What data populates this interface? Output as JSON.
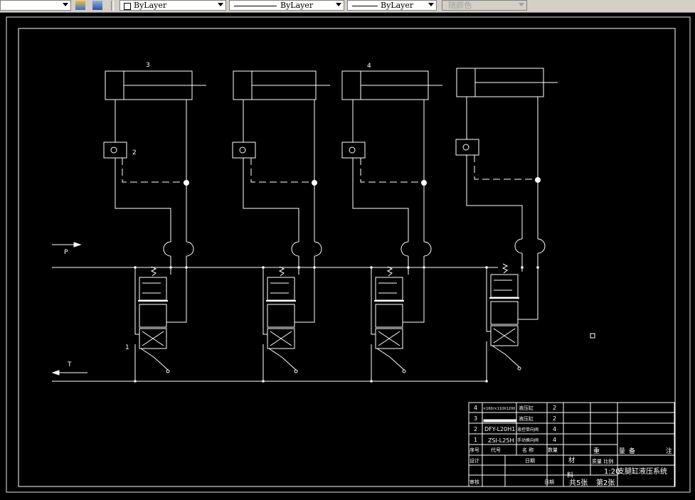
{
  "toolbar": {
    "color_control": "ByLayer",
    "linetype_control": "ByLayer",
    "lineweight_control": "ByLayer",
    "plotstyle_control": "随颜色"
  },
  "drawing": {
    "labels": {
      "item_3": "3",
      "item_4": "4",
      "item_2": "2",
      "item_1": "1",
      "port_p": "P",
      "port_t": "T"
    }
  },
  "title_block": {
    "parts": [
      {
        "no": "4",
        "code": "×160/×110X1200",
        "name": "液压缸",
        "qty": "2"
      },
      {
        "no": "3",
        "code": "",
        "name": "液压缸",
        "qty": "2"
      },
      {
        "no": "2",
        "code": "DFY-L20H1",
        "name": "液控单向阀",
        "qty": "4"
      },
      {
        "no": "1",
        "code": "ZSI-L25H",
        "name": "手动换向阀",
        "qty": "4"
      }
    ],
    "header": {
      "no": "序号",
      "code": "代号",
      "name": "名 称",
      "qty": "数量",
      "material": "材",
      "weight": "重 量",
      "remark": "备 注"
    },
    "scale_label": "质量 比例",
    "scale": "1:20",
    "title": "支腿缸液压系统",
    "material_row": "料",
    "sheets": "共5张",
    "sheet": "第2张",
    "design": "设计",
    "check": "审核",
    "date": "日期"
  }
}
